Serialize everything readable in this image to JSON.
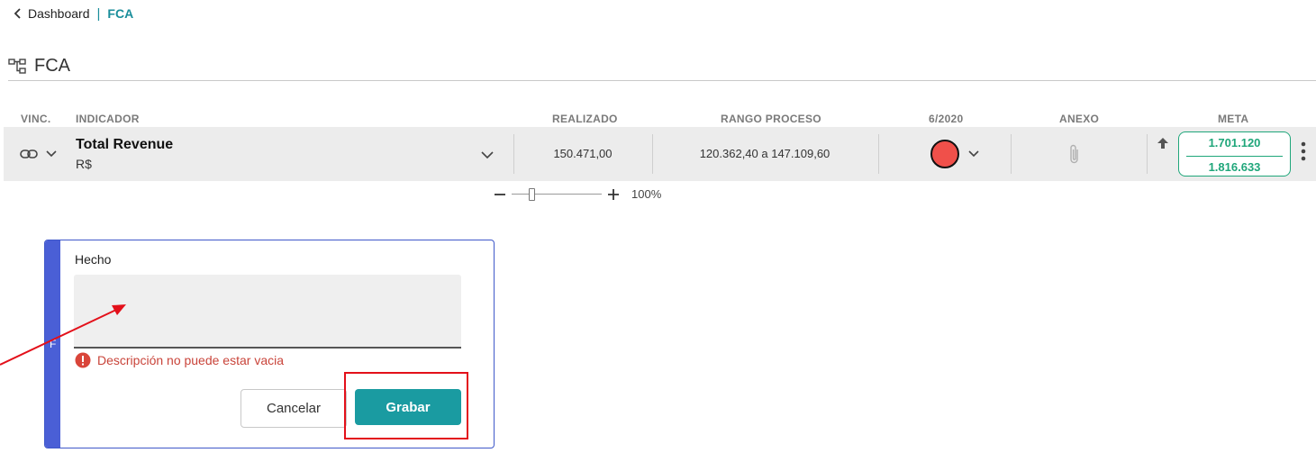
{
  "breadcrumb": {
    "parent": "Dashboard",
    "separator": "|",
    "current": "FCA"
  },
  "page": {
    "title": "FCA"
  },
  "table": {
    "headers": {
      "vinc": "VINC.",
      "indicador": "INDICADOR",
      "realizado": "REALIZADO",
      "rango": "RANGO PROCESO",
      "period": "6/2020",
      "anexo": "ANEXO",
      "meta": "META"
    },
    "row": {
      "indicator_name": "Total Revenue",
      "unit": "R$",
      "realizado": "150.471,00",
      "rango": "120.362,40 a 147.109,60",
      "status_color": "#f0504a",
      "meta_top": "1.701.120",
      "meta_bottom": "1.816.633"
    }
  },
  "zoom": {
    "level": "100%",
    "slider_fraction": 0.22
  },
  "form": {
    "strip_letter": "F",
    "label": "Hecho",
    "value": "",
    "placeholder": "",
    "error": "Descripción no puede estar vacia",
    "cancel_label": "Cancelar",
    "save_label": "Grabar"
  },
  "colors": {
    "accent": "#1a9ba1",
    "error": "#c9443a",
    "panel_border": "#3f58c9",
    "highlight": "#e3101a",
    "meta_green": "#1fa67a"
  }
}
